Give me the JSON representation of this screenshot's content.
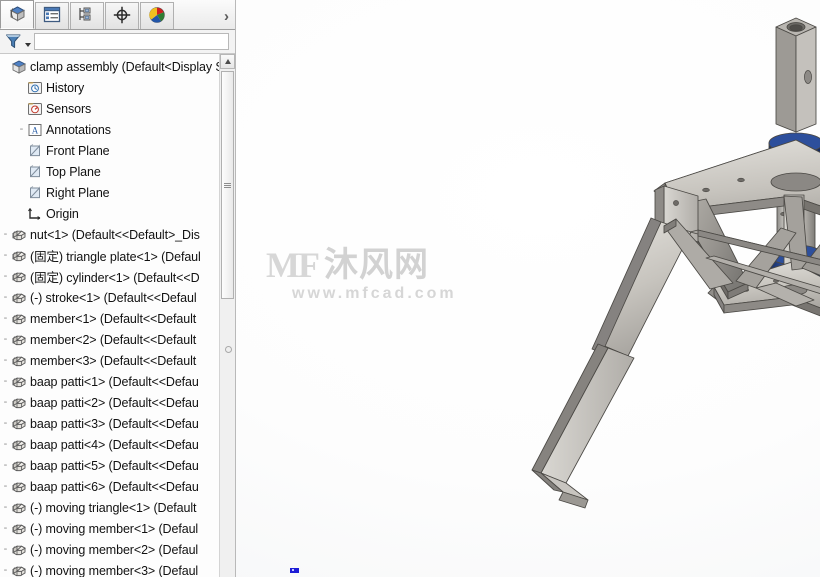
{
  "window": {
    "title": "clamp assembly"
  },
  "tabstrip": {
    "tabs": [
      {
        "id": "feature-manager",
        "name": "feature-manager-tab",
        "icon": "blue-cube-icon",
        "selected": true
      },
      {
        "id": "property-manager",
        "name": "property-manager-tab",
        "icon": "list-panel-icon",
        "selected": false
      },
      {
        "id": "configuration-manager",
        "name": "configuration-manager-tab",
        "icon": "configuration-icon",
        "selected": false
      },
      {
        "id": "dimxpert-manager",
        "name": "dimxpert-manager-tab",
        "icon": "crosshair-icon",
        "selected": false
      },
      {
        "id": "display-manager",
        "name": "display-manager-tab",
        "icon": "color-wheel-icon",
        "selected": false
      }
    ],
    "more_label": "›"
  },
  "filter": {
    "icon": "funnel-filter-icon",
    "value": "",
    "placeholder": ""
  },
  "tree": {
    "root": {
      "label": "clamp assembly  (Default<Display S",
      "icon": "assembly-icon"
    },
    "items": [
      {
        "label": "History",
        "icon": "history-icon",
        "level": 1,
        "prefix": ""
      },
      {
        "label": "Sensors",
        "icon": "sensors-icon",
        "level": 1,
        "prefix": ""
      },
      {
        "label": "Annotations",
        "icon": "annotations-icon",
        "level": 1,
        "prefix": "-"
      },
      {
        "label": "Front Plane",
        "icon": "plane-icon",
        "level": 1,
        "prefix": ""
      },
      {
        "label": "Top Plane",
        "icon": "plane-icon",
        "level": 1,
        "prefix": ""
      },
      {
        "label": "Right Plane",
        "icon": "plane-icon",
        "level": 1,
        "prefix": ""
      },
      {
        "label": "Origin",
        "icon": "origin-icon",
        "level": 1,
        "prefix": ""
      },
      {
        "label": "nut<1> (Default<<Default>_Dis",
        "icon": "part-icon",
        "level": 0,
        "prefix": "-"
      },
      {
        "label": "(固定) triangle plate<1> (Defaul",
        "icon": "part-icon",
        "level": 0,
        "prefix": "-"
      },
      {
        "label": "(固定) cylinder<1> (Default<<D",
        "icon": "part-icon",
        "level": 0,
        "prefix": "-"
      },
      {
        "label": "(-) stroke<1> (Default<<Defaul",
        "icon": "part-icon",
        "level": 0,
        "prefix": "-"
      },
      {
        "label": "member<1> (Default<<Default",
        "icon": "part-icon",
        "level": 0,
        "prefix": "-"
      },
      {
        "label": "member<2> (Default<<Default",
        "icon": "part-icon",
        "level": 0,
        "prefix": "-"
      },
      {
        "label": "member<3> (Default<<Default",
        "icon": "part-icon",
        "level": 0,
        "prefix": "-"
      },
      {
        "label": "baap patti<1> (Default<<Defau",
        "icon": "part-icon",
        "level": 0,
        "prefix": "-"
      },
      {
        "label": "baap patti<2> (Default<<Defau",
        "icon": "part-icon",
        "level": 0,
        "prefix": "-"
      },
      {
        "label": "baap patti<3> (Default<<Defau",
        "icon": "part-icon",
        "level": 0,
        "prefix": "-"
      },
      {
        "label": "baap patti<4> (Default<<Defau",
        "icon": "part-icon",
        "level": 0,
        "prefix": "-"
      },
      {
        "label": "baap patti<5> (Default<<Defau",
        "icon": "part-icon",
        "level": 0,
        "prefix": "-"
      },
      {
        "label": "baap patti<6> (Default<<Defau",
        "icon": "part-icon",
        "level": 0,
        "prefix": "-"
      },
      {
        "label": "(-) moving triangle<1> (Default",
        "icon": "part-icon",
        "level": 0,
        "prefix": "-"
      },
      {
        "label": "(-) moving member<1> (Defaul",
        "icon": "part-icon",
        "level": 0,
        "prefix": "-"
      },
      {
        "label": "(-) moving member<2> (Defaul",
        "icon": "part-icon",
        "level": 0,
        "prefix": "-"
      },
      {
        "label": "(-) moving member<3> (Defaul",
        "icon": "part-icon",
        "level": 0,
        "prefix": "-"
      }
    ]
  },
  "watermark": {
    "mark": "MF",
    "chinese": "沐风网",
    "url": "www.mfcad.com"
  },
  "model": {
    "name": "three-jaw-bearing-puller",
    "colors": {
      "steel_light": "#d4d2cd",
      "steel_mid": "#b9b6b0",
      "steel_dark": "#8f8c87",
      "steel_edge": "#5c5a57",
      "collar_blue": "#21408a",
      "collar_blue_dark": "#16306c"
    }
  }
}
